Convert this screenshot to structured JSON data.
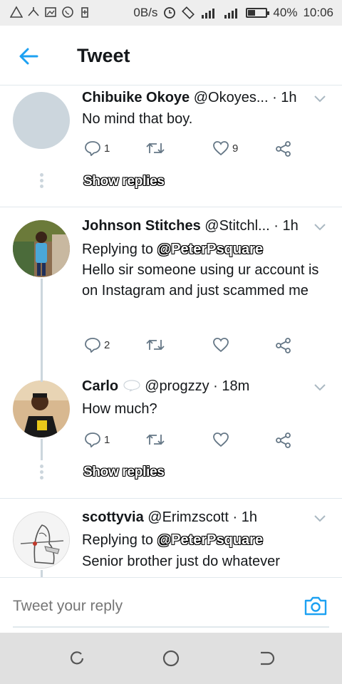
{
  "status_bar": {
    "net_speed": "0B/s",
    "battery": "40%",
    "battery_level": 0.4,
    "time": "10:06"
  },
  "header": {
    "title": "Tweet"
  },
  "tweets": [
    {
      "name": "Chibuike Okoye",
      "handle": "@Okoyes...",
      "time": "· 1h",
      "body": "No mind that boy.",
      "reply_count": "1",
      "retweet_count": "",
      "like_count": "9",
      "show_replies": "Show replies"
    },
    {
      "name": "Johnson Stitches",
      "handle": "@Stitchl...",
      "time": "· 1h",
      "replying_to": "Replying to",
      "replying_handle": "@PeterPsquare",
      "body": "Hello sir someone using ur account is on Instagram and just scammed me",
      "reply_count": "2",
      "retweet_count": "",
      "like_count": ""
    },
    {
      "name": "Carlo",
      "handle": "@progzzy",
      "time": "· 18m",
      "body": "How much?",
      "reply_count": "1",
      "retweet_count": "",
      "like_count": "",
      "show_replies": "Show replies"
    },
    {
      "name": "scottyvia",
      "handle": "@Erimzscott",
      "time": "· 1h",
      "replying_to": "Replying to",
      "replying_handle": "@PeterPsquare",
      "body": "Senior brother just do whatever"
    }
  ],
  "reply_bar": {
    "placeholder": "Tweet your reply"
  },
  "colors": {
    "accent": "#1da1f2",
    "icon_gray": "#657786",
    "divider": "#e1e8ed"
  }
}
